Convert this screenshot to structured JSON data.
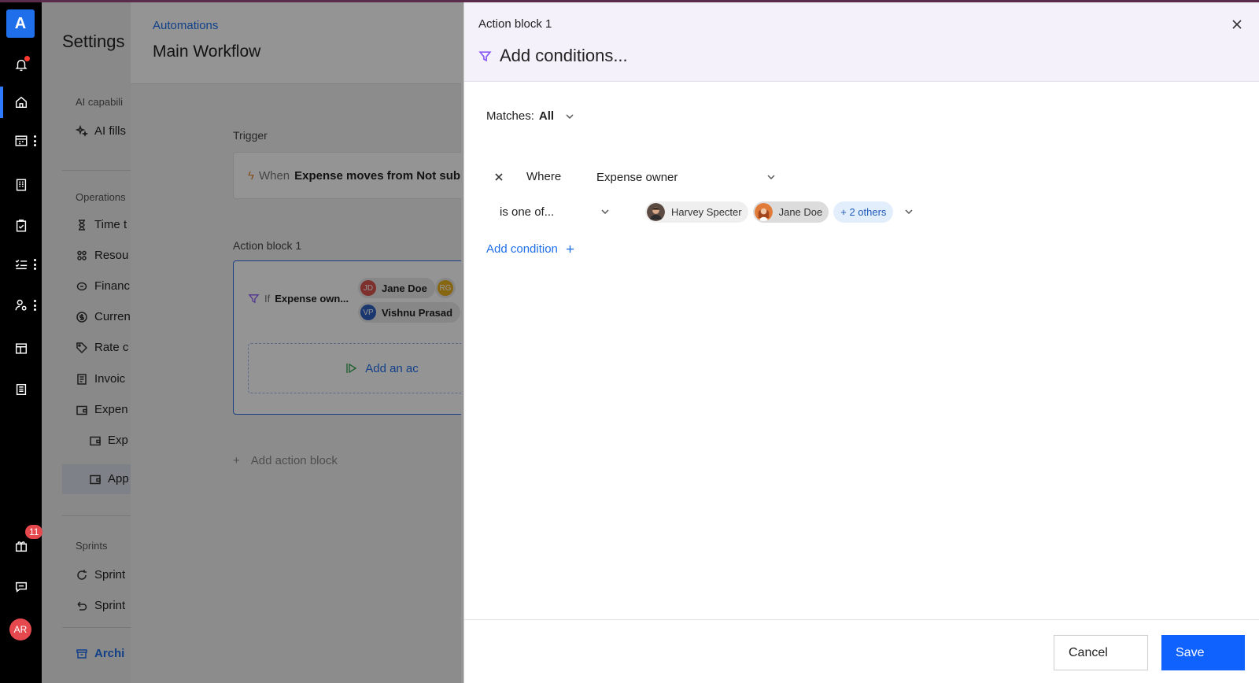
{
  "rail": {
    "logo": "A",
    "gift_badge": "11",
    "avatar_initials": "AR",
    "active_color": "#2f7bff"
  },
  "settings": {
    "title": "Settings",
    "section_ai": "AI capabili",
    "item_ai_fills": "AI fills",
    "section_operations": "Operations",
    "items": [
      "Time t",
      "Resou",
      "Financ",
      "Curren",
      "Rate c",
      "Invoic",
      "Expen"
    ],
    "sub_items": [
      "Exp",
      "App"
    ],
    "section_sprints": "Sprints",
    "sprint_items": [
      "Sprint",
      "Sprint"
    ],
    "archive": "Archi"
  },
  "workflow": {
    "breadcrumb": "Automations",
    "title": "Main Workflow",
    "trigger_label": "Trigger",
    "trigger_when": "When",
    "trigger_text": "Expense moves from Not sub",
    "action_block_label": "Action block 1",
    "if_text": "If",
    "if_field": "Expense own...",
    "chips": [
      {
        "initials": "JD",
        "name": "Jane Doe",
        "color": "#d9534f"
      },
      {
        "initials": "RG",
        "name": "",
        "color": "#e8b020"
      },
      {
        "initials": "VP",
        "name": "Vishnu Prasad",
        "color": "#2f5fbf"
      }
    ],
    "add_action": "Add an ac",
    "add_action_block": "Add action block"
  },
  "drawer": {
    "label": "Action block 1",
    "title": "Add conditions...",
    "matches_prefix": "Matches:",
    "matches_value": "All",
    "condition": {
      "where": "Where",
      "field": "Expense owner",
      "operator": "is one of...",
      "values": [
        {
          "name": "Harvey Specter"
        },
        {
          "name": "Jane Doe"
        }
      ],
      "more": "+ 2 others"
    },
    "add_condition": "Add condition",
    "cancel": "Cancel",
    "save": "Save",
    "accent": "#0f62fe"
  }
}
